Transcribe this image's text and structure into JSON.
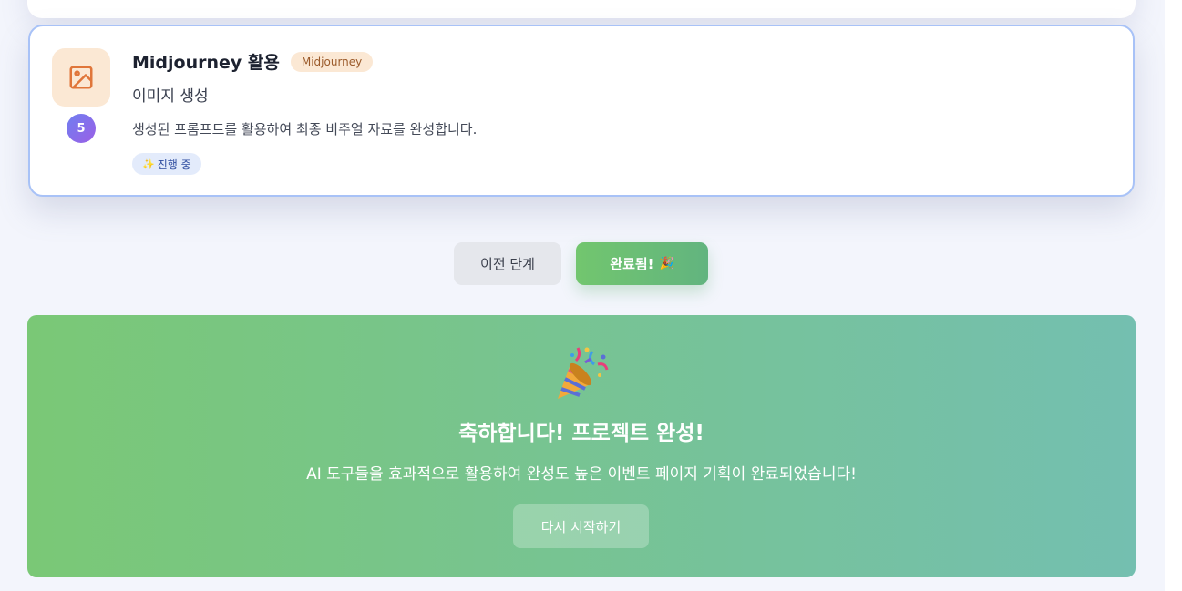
{
  "step": {
    "number": "5",
    "title": "Midjourney 활용",
    "tool_badge": "Midjourney",
    "subtitle": "이미지 생성",
    "description": "생성된 프롬프트를 활용하여 최종 비주얼 자료를 완성합니다.",
    "status": "진행 중",
    "icon": "image-icon",
    "status_icon": "sparkle-icon"
  },
  "nav": {
    "prev_label": "이전 단계",
    "done_label": "완료됨!",
    "done_emoji": "🎉"
  },
  "banner": {
    "icon": "party-popper-icon",
    "title": "축하합니다! 프로젝트 완성!",
    "message": "AI 도구들을 효과적으로 활용하여 완성도 높은 이벤트 페이지 기획이 완료되었습니다!",
    "restart_label": "다시 시작하기"
  },
  "colors": {
    "accent_blue_border": "#a8c2f7",
    "icon_bg": "#fbe8d4",
    "icon_stroke": "#e0763a",
    "success_green": "#72c66e",
    "banner_end": "#74bfb0"
  }
}
